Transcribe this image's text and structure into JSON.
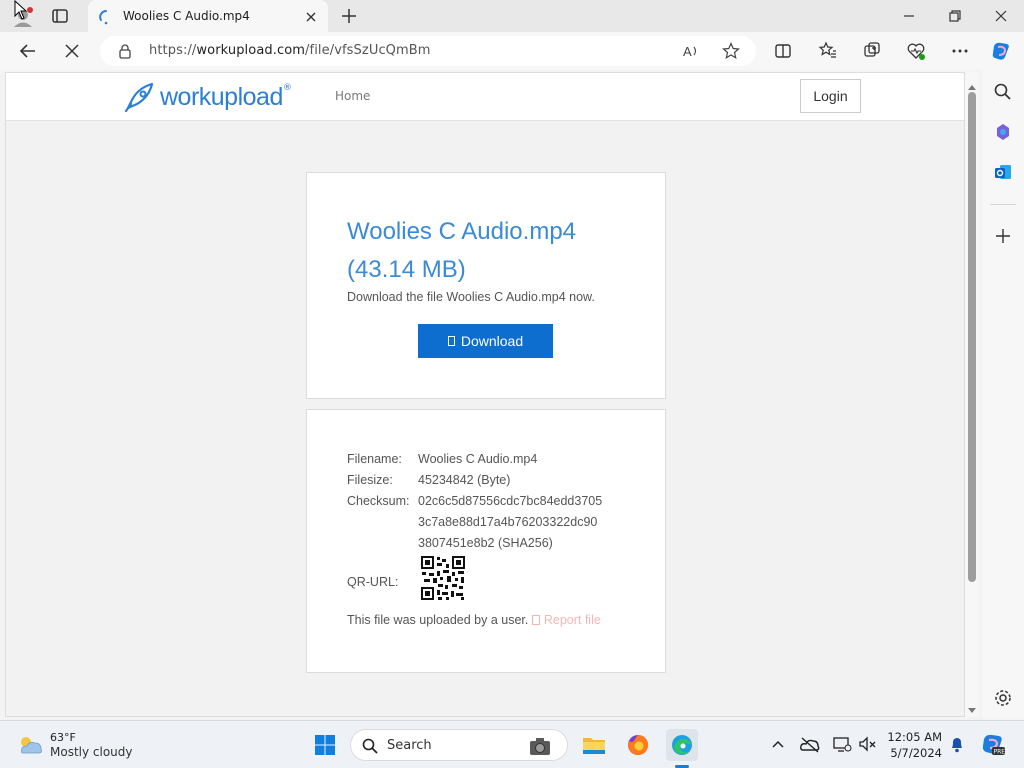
{
  "browser": {
    "tab_title": "Woolies C Audio.mp4",
    "url_prefix": "https://",
    "url_host": "workupload.com",
    "url_path": "/file/vfsSzUcQmBm"
  },
  "site": {
    "logo_text": "workupload",
    "logo_reg": "®",
    "nav_home": "Home",
    "login_label": "Login"
  },
  "file": {
    "title": "Woolies C Audio.mp4 (43.14 MB)",
    "description": "Download the file Woolies C Audio.mp4 now.",
    "download_label": "Download",
    "filename_label": "Filename:",
    "filename_value": "Woolies C Audio.mp4",
    "filesize_label": "Filesize:",
    "filesize_value": "45234842 (Byte)",
    "checksum_label": "Checksum:",
    "checksum_line1": "02c6c5d87556cdc7bc84edd3705",
    "checksum_line2": "3c7a8e88d17a4b76203322dc90",
    "checksum_line3": "3807451e8b2 (SHA256)",
    "qr_label": "QR-URL:",
    "uploaded_text": "This file was uploaded by a user.",
    "report_label": "Report file"
  },
  "taskbar": {
    "weather_temp": "63°F",
    "weather_cond": "Mostly cloudy",
    "search_label": "Search",
    "time": "12:05 AM",
    "date": "5/7/2024"
  },
  "colors": {
    "accent": "#0d6ecf",
    "title_blue": "#3a8ad8",
    "report_pink": "#f2b8b8"
  }
}
